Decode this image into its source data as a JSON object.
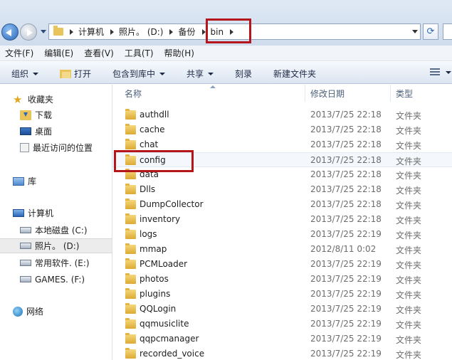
{
  "breadcrumb": [
    "计算机",
    "照片。 (D:)",
    "备份",
    "bin"
  ],
  "menu": [
    "文件(F)",
    "编辑(E)",
    "查看(V)",
    "工具(T)",
    "帮助(H)"
  ],
  "toolbar": {
    "organize": "组织",
    "open": "打开",
    "include_in_library": "包含到库中",
    "share": "共享",
    "burn": "刻录",
    "new_folder": "新建文件夹"
  },
  "sidebar": {
    "favorites": "收藏夹",
    "downloads": "下载",
    "desktop": "桌面",
    "recent": "最近访问的位置",
    "libraries": "库",
    "computer": "计算机",
    "drive_c": "本地磁盘 (C:)",
    "drive_d": "照片。 (D:)",
    "drive_e": "常用软件. (E:)",
    "drive_f": "GAMES. (F:)",
    "network": "网络"
  },
  "columns": {
    "name": "名称",
    "date": "修改日期",
    "type": "类型"
  },
  "files": [
    {
      "name": "authdll",
      "date": "2013/7/25 22:18",
      "type": "文件夹"
    },
    {
      "name": "cache",
      "date": "2013/7/25 22:18",
      "type": "文件夹"
    },
    {
      "name": "chat",
      "date": "2013/7/25 22:18",
      "type": "文件夹"
    },
    {
      "name": "config",
      "date": "2013/7/25 22:18",
      "type": "文件夹"
    },
    {
      "name": "data",
      "date": "2013/7/25 22:18",
      "type": "文件夹"
    },
    {
      "name": "Dlls",
      "date": "2013/7/25 22:18",
      "type": "文件夹"
    },
    {
      "name": "DumpCollector",
      "date": "2013/7/25 22:18",
      "type": "文件夹"
    },
    {
      "name": "inventory",
      "date": "2013/7/25 22:18",
      "type": "文件夹"
    },
    {
      "name": "logs",
      "date": "2013/7/25 22:19",
      "type": "文件夹"
    },
    {
      "name": "mmap",
      "date": "2012/8/11 0:02",
      "type": "文件夹"
    },
    {
      "name": "PCMLoader",
      "date": "2013/7/25 22:19",
      "type": "文件夹"
    },
    {
      "name": "photos",
      "date": "2013/7/25 22:19",
      "type": "文件夹"
    },
    {
      "name": "plugins",
      "date": "2013/7/25 22:19",
      "type": "文件夹"
    },
    {
      "name": "QQLogin",
      "date": "2013/7/25 22:19",
      "type": "文件夹"
    },
    {
      "name": "qqmusiclite",
      "date": "2013/7/25 22:19",
      "type": "文件夹"
    },
    {
      "name": "qqpcmanager",
      "date": "2013/7/25 22:19",
      "type": "文件夹"
    },
    {
      "name": "recorded_voice",
      "date": "2013/7/25 22:19",
      "type": "文件夹"
    }
  ],
  "colors": {
    "highlight": "#b4161b",
    "accent": "#2a66b8"
  }
}
